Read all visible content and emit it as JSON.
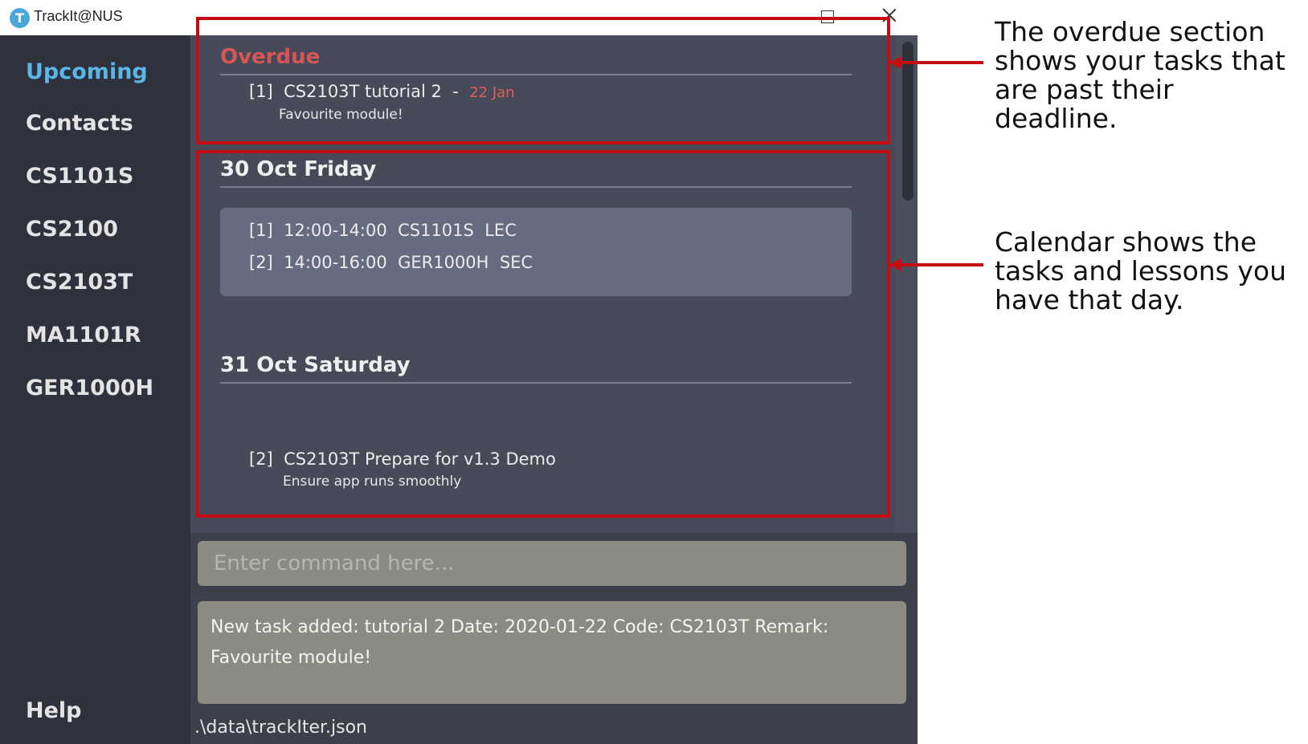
{
  "window": {
    "title": "TrackIt@NUS",
    "icon_letter": "T"
  },
  "sidebar": {
    "items": [
      {
        "label": "Upcoming"
      },
      {
        "label": "Contacts"
      },
      {
        "label": "CS1101S"
      },
      {
        "label": "CS2100"
      },
      {
        "label": "CS2103T"
      },
      {
        "label": "MA1101R"
      },
      {
        "label": "GER1000H"
      }
    ],
    "help": "Help"
  },
  "overdue": {
    "title": "Overdue",
    "task": {
      "index": "[1]",
      "text": "CS2103T tutorial 2",
      "separator": "-",
      "date": "22 Jan",
      "remark": "Favourite module!"
    }
  },
  "days": [
    {
      "title": "30 Oct Friday",
      "lessons": [
        {
          "index": "[1]",
          "time": "12:00-14:00",
          "module": "CS1101S",
          "type": "LEC"
        },
        {
          "index": "[2]",
          "time": "14:00-16:00",
          "module": "GER1000H",
          "type": "SEC"
        }
      ]
    },
    {
      "title": "31 Oct Saturday",
      "tasks": [
        {
          "index": "[2]",
          "text": "CS2103T Prepare for v1.3 Demo",
          "remark": "Ensure app runs smoothly"
        }
      ]
    }
  ],
  "command": {
    "placeholder": "Enter command here..."
  },
  "result": {
    "text": "New task added: tutorial 2 Date: 2020-01-22 Code: CS2103T Remark: Favourite module!"
  },
  "status_bar": {
    "path": ".\\data\\trackIter.json"
  },
  "annotations": {
    "overdue_note": "The overdue section shows your tasks that are past their deadline.",
    "calendar_note": "Calendar shows the tasks and lessons you have that day."
  },
  "colors": {
    "highlight": "#c40d13",
    "active_nav": "#5ab6e6",
    "overdue": "#d65656"
  }
}
